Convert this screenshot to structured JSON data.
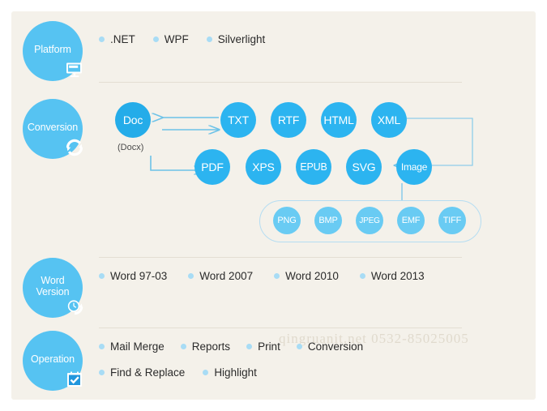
{
  "theme": {
    "page_background": "#ffffff",
    "panel_background": "#f4f1ea",
    "bubble_color": "#56c3f2",
    "format_color": "#2cb4f0",
    "format_doc_color": "#24ace9",
    "format_small_color": "#69cbf3",
    "bullet_dot_color": "#a8dcf5",
    "divider_color": "#e3ded3",
    "connector_color": "#6cc2e8",
    "text_color": "#2b2b2b",
    "watermark_color": "#e0dacd"
  },
  "sections": {
    "platform": {
      "label": "Platform",
      "badge_icon": "monitor-icon",
      "items": [
        ".NET",
        "WPF",
        "Silverlight"
      ]
    },
    "conversion": {
      "label": "Conversion",
      "badge_icon": "refresh-sync-icon",
      "source": {
        "name": "Doc",
        "sub": "(Docx)"
      },
      "targets_row1": [
        "TXT",
        "RTF",
        "HTML",
        "XML"
      ],
      "targets_row2": [
        "PDF",
        "XPS",
        "EPUB",
        "SVG",
        "Image"
      ],
      "image_formats": [
        "PNG",
        "BMP",
        "JPEG",
        "EMF",
        "TIFF"
      ]
    },
    "word_version": {
      "label_line1": "Word",
      "label_line2": "Version",
      "badge_icon": "clock-history-icon",
      "items": [
        "Word 97-03",
        "Word 2007",
        "Word 2010",
        "Word 2013"
      ]
    },
    "operation": {
      "label": "Operation",
      "badge_icon": "checkbox-checked-icon",
      "items_row1": [
        "Mail Merge",
        "Reports",
        "Print",
        "Conversion"
      ],
      "items_row2": [
        "Find & Replace",
        "Highlight"
      ]
    }
  },
  "watermark": {
    "text": "qingruanit.net  0532-85025005"
  }
}
